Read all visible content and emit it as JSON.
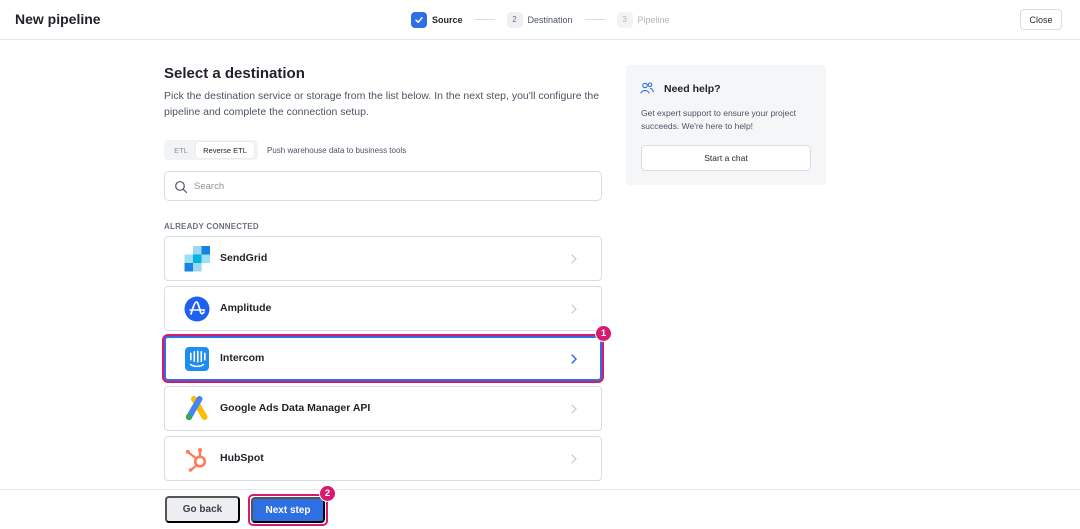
{
  "header": {
    "title": "New pipeline",
    "close_label": "Close",
    "steps": [
      {
        "number": "",
        "label": "Source",
        "state": "complete"
      },
      {
        "number": "2",
        "label": "Destination",
        "state": "current"
      },
      {
        "number": "3",
        "label": "Pipeline",
        "state": "upcoming"
      }
    ]
  },
  "main": {
    "title": "Select a destination",
    "description": "Pick the destination service or storage from the list below. In the next step, you'll configure the pipeline and complete the connection setup.",
    "mode_toggle": {
      "options": [
        "ETL",
        "Reverse ETL"
      ],
      "selected": "Reverse ETL",
      "hint": "Push warehouse data to business tools"
    },
    "search": {
      "placeholder": "Search",
      "value": ""
    },
    "section_label": "ALREADY CONNECTED",
    "destinations": [
      {
        "name": "SendGrid",
        "icon": "sendgrid-logo",
        "selected": false
      },
      {
        "name": "Amplitude",
        "icon": "amplitude-logo",
        "selected": false
      },
      {
        "name": "Intercom",
        "icon": "intercom-logo",
        "selected": true
      },
      {
        "name": "Google Ads Data Manager API",
        "icon": "google-ads-logo",
        "selected": false
      },
      {
        "name": "HubSpot",
        "icon": "hubspot-logo",
        "selected": false
      }
    ]
  },
  "help": {
    "title": "Need help?",
    "text": "Get expert support to ensure your project succeeds. We're here to help!",
    "button_label": "Start a chat",
    "icon": "people-icon"
  },
  "footer": {
    "back_label": "Go back",
    "next_label": "Next step"
  },
  "annotations": {
    "marker_1": "1",
    "marker_2": "2"
  },
  "colors": {
    "accent": "#2f6fe4",
    "marker": "#d61a6d"
  }
}
